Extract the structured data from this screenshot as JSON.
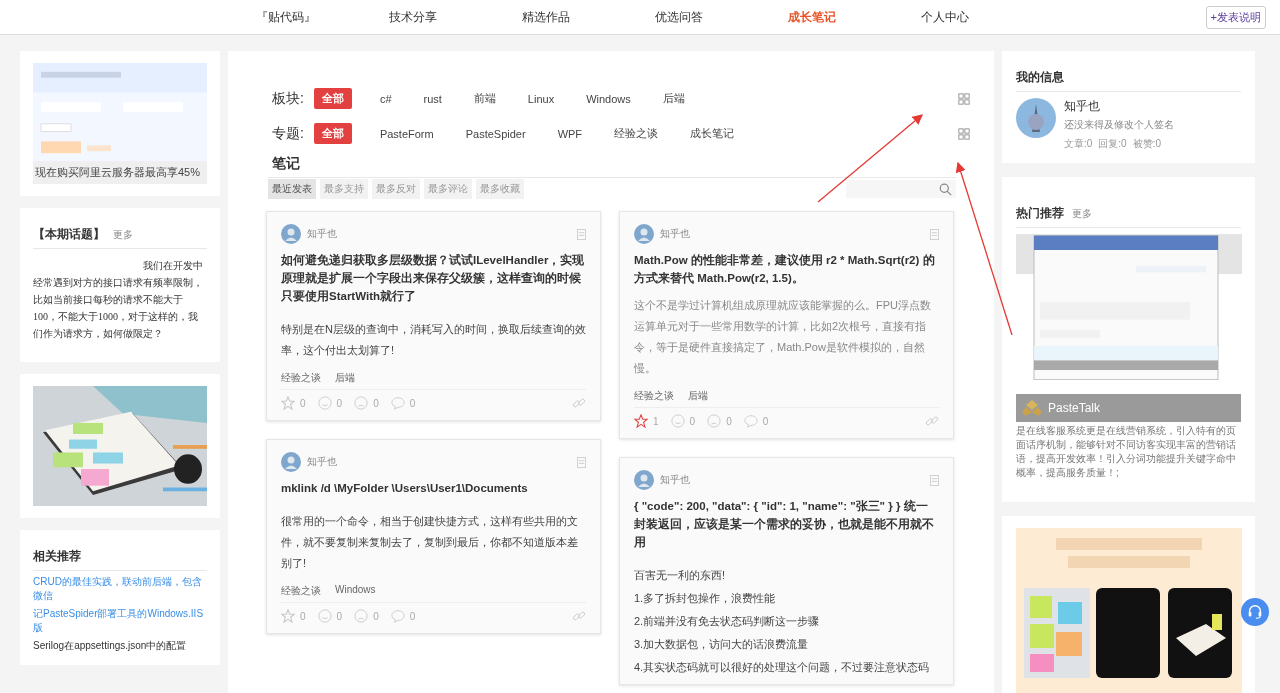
{
  "nav": {
    "items": [
      {
        "label": "『贴代码』",
        "selected": false
      },
      {
        "label": "技术分享",
        "selected": false
      },
      {
        "label": "精选作品",
        "selected": false
      },
      {
        "label": "优选问答",
        "selected": false
      },
      {
        "label": "成长笔记",
        "selected": true
      },
      {
        "label": "个人中心",
        "selected": false
      }
    ],
    "action": "+发表说明"
  },
  "left": {
    "ad": {
      "kind": "picture",
      "caption": "现在购买阿里云服务器最高享45%"
    },
    "topic": {
      "title": "【本期话题】",
      "more": "更多",
      "text": "我们在开发中经常遇到对方的接口请求有频率限制，比如当前接口每秒的请求不能大于100，不能大于1000，对于这样的，我们作为请求方，如何做限定？"
    },
    "related": {
      "title": "相关推荐",
      "items": [
        {
          "label": "CRUD的最佳实践，联动前后端，包含微信",
          "kind": "link"
        },
        {
          "label": "记PasteSpider部署工具的Windows.IIS版",
          "kind": "link"
        },
        {
          "label": "Serilog在appsettings.json中的配置",
          "kind": "plain"
        }
      ]
    }
  },
  "filters": [
    {
      "label": "板块:",
      "options": [
        {
          "label": "全部",
          "selected": true
        },
        {
          "label": "c#",
          "selected": false
        },
        {
          "label": "rust",
          "selected": false
        },
        {
          "label": "前端",
          "selected": false
        },
        {
          "label": "Linux",
          "selected": false
        },
        {
          "label": "Windows",
          "selected": false
        },
        {
          "label": "后端",
          "selected": false
        }
      ]
    },
    {
      "label": "专题:",
      "options": [
        {
          "label": "全部",
          "selected": true
        },
        {
          "label": "PasteForm",
          "selected": false
        },
        {
          "label": "PasteSpider",
          "selected": false
        },
        {
          "label": "WPF",
          "selected": false
        },
        {
          "label": "经验之谈",
          "selected": false
        },
        {
          "label": "成长笔记",
          "selected": false
        }
      ]
    }
  ],
  "notes": {
    "title": "笔记",
    "sort_tabs": [
      {
        "label": "最近发表",
        "selected": true
      },
      {
        "label": "最多支持",
        "selected": false
      },
      {
        "label": "最多反对",
        "selected": false
      },
      {
        "label": "最多评论",
        "selected": false
      },
      {
        "label": "最多收藏",
        "selected": false
      }
    ],
    "columns": [
      [
        {
          "author": "知乎也",
          "title": "如何避免递归获取多层级数据？试试ILevelHandler，实现原理就是扩展一个字段出来保存父级簇，这样查询的时候只要使用StartWith就行了",
          "body": [
            "特别是在N层级的查询中，消耗写入的时间，换取后续查询的效率，这个付出太划算了!"
          ],
          "tags": [
            "经验之谈",
            "后端"
          ],
          "starred": false,
          "stars": "0",
          "likes": "0",
          "dislikes": "0",
          "comments": "0"
        },
        {
          "author": "知乎也",
          "title": "mklink /d \\MyFolder \\Users\\User1\\Documents",
          "body": [
            "很常用的一个命令，相当于创建快捷方式，这样有些共用的文件，就不要复制来复制去了，复制到最后，你都不知道版本差别了!"
          ],
          "tags": [
            "经验之谈",
            "Windows"
          ],
          "starred": false,
          "stars": "0",
          "likes": "0",
          "dislikes": "0",
          "comments": "0"
        }
      ],
      [
        {
          "author": "知乎也",
          "title": "Math.Pow 的性能非常差，建议使用 r2 * Math.Sqrt(r2) 的方式来替代 Math.Pow(r2, 1.5)。",
          "body": [
            "这个不是学过计算机组成原理就应该能掌握的么。FPU浮点数运算单元对于一些常用数学的计算，比如2次根号，直接有指令，等于是硬件直接搞定了，Math.Pow是软件模拟的，自然慢。"
          ],
          "tags": [
            "经验之谈",
            "后端"
          ],
          "starred": true,
          "stars": "1",
          "likes": "0",
          "dislikes": "0",
          "comments": "0"
        },
        {
          "author": "知乎也",
          "title": "{ \"code\": 200, \"data\": { \"id\": 1, \"name\": \"张三\" } } 统一封装返回，应该是某一个需求的妥协，也就是能不用就不用",
          "body": [
            "百害无一利的东西!",
            "1.多了拆封包操作，浪费性能",
            "2.前端并没有免去状态码判断这一步骤",
            "3.加大数据包，访问大的话浪费流量",
            "4.其实状态码就可以很好的处理这个问题，不过要注意状态码"
          ]
        }
      ]
    ]
  },
  "right": {
    "info": {
      "title": "我的信息",
      "name": "知乎也",
      "signature": "还没来得及修改个人签名",
      "stats": [
        "文章:0",
        "回复:0",
        "被赞:0"
      ]
    },
    "hot": {
      "title": "热门推荐",
      "more": "更多",
      "caption": "PasteTalk",
      "text": "是在线客服系统更是在线营销系统，引入特有的页面话序机制，能够针对不同访客实现丰富的营销话语，提高开发效率！引入分词功能提升关键字命中概率，提高服务质量！;"
    }
  }
}
